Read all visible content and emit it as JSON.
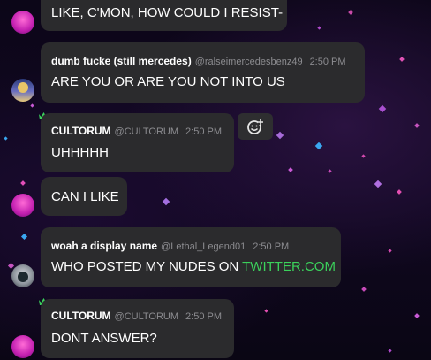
{
  "messages": [
    {
      "text": "LIKE, C'MON, HOW COULD I RESIST-"
    },
    {
      "name": "dumb fucke (still mercedes)",
      "handle": "@ralseimercedesbenz49",
      "time": "2:50 PM",
      "text": "ARE YOU OR ARE YOU NOT INTO US"
    },
    {
      "name": "CULTORUM",
      "handle": "@CULTORUM",
      "time": "2:50 PM",
      "text": "UHHHHH"
    },
    {
      "text": "CAN I LIKE"
    },
    {
      "name": "woah a display name",
      "handle": "@Lethal_Legend01",
      "time": "2:50 PM",
      "text_prefix": "WHO POSTED MY NUDES ON ",
      "link_text": "TWITTER.COM"
    },
    {
      "name": "CULTORUM",
      "handle": "@CULTORUM",
      "time": "2:50 PM",
      "text": "DONT ANSWER?"
    }
  ],
  "icons": {
    "crown": "crown-icon",
    "add_reaction": "add-reaction-icon"
  },
  "colors": {
    "bubble": "#2b2b2d",
    "crown": "#3bd15b",
    "link": "#3bd15b"
  }
}
